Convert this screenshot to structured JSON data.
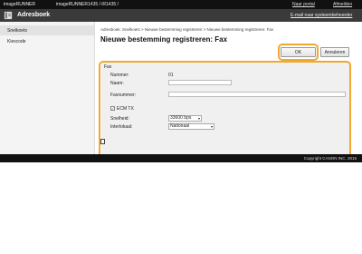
{
  "topbar": {
    "app_name": "imageRUNNER",
    "model": "imageRUNNER1435 / iR1435 /",
    "portal_link": "Naar portal",
    "logout_link": "Afmelden"
  },
  "subbar": {
    "title": "Adresboek",
    "mail_link": "E-mail naar systeembeheerder"
  },
  "sidebar": {
    "items": [
      {
        "label": "Snelkoets"
      },
      {
        "label": "Kiescode"
      }
    ]
  },
  "main": {
    "breadcrumb": "Adresboek: Snelkoets > Nieuwe bestemming registreren > Nieuwe bestemming registreren: Fax",
    "heading": "Nieuwe bestemming registreren: Fax",
    "ok_label": "OK",
    "cancel_label": "Annuleren"
  },
  "form": {
    "section_label": "Fax",
    "nummer_label": "Nummer:",
    "nummer_value": "01",
    "naam_label": "Naam:",
    "naam_value": "",
    "faxnummer_label": "Faxnummer:",
    "faxnummer_value": "",
    "ecm_label": "ECM TX",
    "ecm_checked": true,
    "snelheid_label": "Snelheid:",
    "snelheid_value": "33600 bps",
    "interlokaal_label": "Interlokaal:",
    "interlokaal_value": "Nationaal"
  },
  "footer": {
    "copyright": "Copyright CANON INC. 2015"
  },
  "colors": {
    "highlight": "#f0a830",
    "topbar": "#111111",
    "subbar": "#3a3a3a"
  }
}
